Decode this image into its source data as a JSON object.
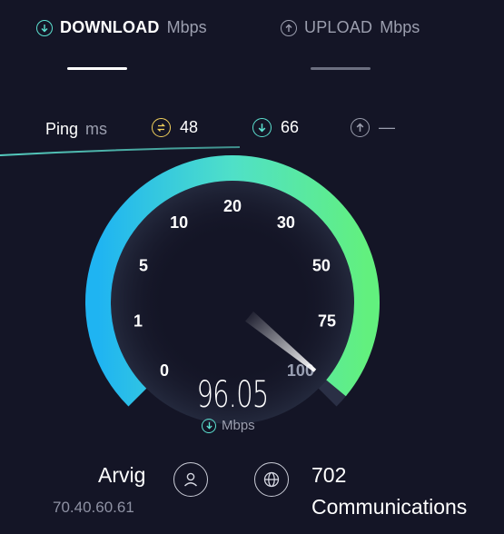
{
  "colors": {
    "background": "#141526",
    "accent_teal": "#5ce1d0",
    "gauge_start": "#1fb4f2",
    "gauge_end": "#62f07e",
    "ping_yellow": "#f2d15c",
    "muted": "#9b9eae"
  },
  "header": {
    "download_label": "DOWNLOAD",
    "download_unit": "Mbps",
    "download_icon": "arrow-down-circle-icon",
    "upload_label": "UPLOAD",
    "upload_unit": "Mbps",
    "upload_icon": "arrow-up-circle-icon"
  },
  "ping": {
    "label": "Ping",
    "unit": "ms",
    "idle_value": "48",
    "idle_icon": "ping-idle-icon",
    "download_value": "66",
    "download_icon": "arrow-down-circle-icon",
    "upload_value": "—",
    "upload_icon": "arrow-up-circle-icon"
  },
  "gauge": {
    "ticks": [
      "0",
      "1",
      "5",
      "10",
      "20",
      "30",
      "50",
      "75",
      "100"
    ],
    "needle_at_scale_fraction": 0.98,
    "speed": "96.05",
    "unit": "Mbps",
    "unit_icon": "arrow-down-circle-icon"
  },
  "client": {
    "isp": "Arvig",
    "ip": "70.40.60.61",
    "icon": "user-icon"
  },
  "server": {
    "name_line1": "702",
    "name_line2": "Communications",
    "icon": "globe-icon"
  }
}
